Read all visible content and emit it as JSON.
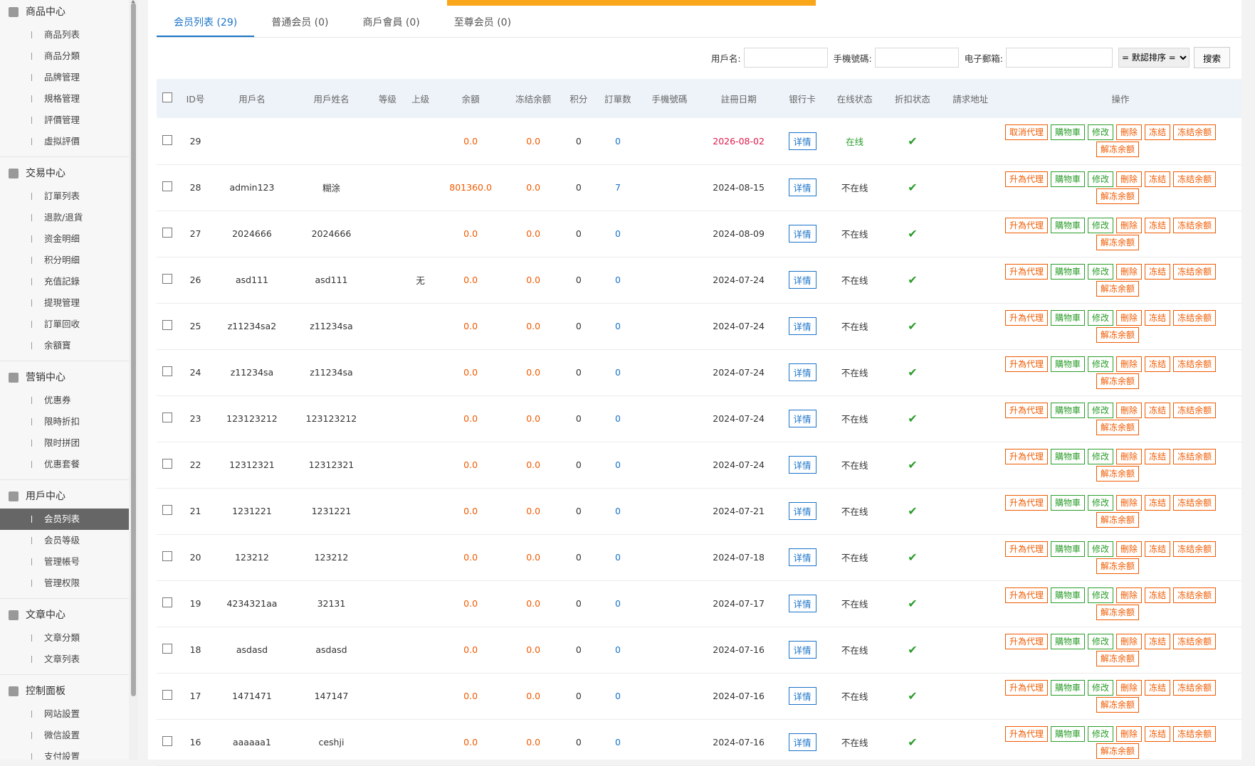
{
  "sidebar": {
    "groups": [
      {
        "title": "商品中心",
        "items": [
          "商品列表",
          "商品分類",
          "品牌管理",
          "規格管理",
          "評價管理",
          "虛拟評價"
        ]
      },
      {
        "title": "交易中心",
        "items": [
          "訂單列表",
          "退款/退貨",
          "资金明细",
          "积分明细",
          "充值記錄",
          "提現管理",
          "訂單回收",
          "余額寶"
        ]
      },
      {
        "title": "营销中心",
        "items": [
          "优惠券",
          "限時折扣",
          "限时拼团",
          "优惠套餐"
        ]
      },
      {
        "title": "用戶中心",
        "items": [
          "会员列表",
          "会员等级",
          "管理帳号",
          "管理权限"
        ]
      },
      {
        "title": "文章中心",
        "items": [
          "文章分類",
          "文章列表"
        ]
      },
      {
        "title": "控制面板",
        "items": [
          "网站設置",
          "微信設置",
          "支付設置"
        ]
      }
    ],
    "active": "会员列表"
  },
  "tabs": [
    "会员列表 (29)",
    "普通会员 (0)",
    "商戶會員 (0)",
    "至尊会员 (0)"
  ],
  "filter": {
    "username_label": "用戶名:",
    "phone_label": "手機號碼:",
    "email_label": "电子郵箱:",
    "sort": "= 默認排序 =",
    "search": "搜索"
  },
  "columns": [
    "ID号",
    "用戶名",
    "用戶姓名",
    "等级",
    "上级",
    "余額",
    "冻结余额",
    "积分",
    "訂單数",
    "手機號碼",
    "註冊日期",
    "银行卡",
    "在线状态",
    "折扣状态",
    "請求地址",
    "操作"
  ],
  "detail_label": "详情",
  "ops": {
    "agent_first": "取消代理",
    "agent": "升為代理",
    "cart": "購物車",
    "edit": "修改",
    "delete": "刪除",
    "freeze": "冻结",
    "freeze_bal": "冻结余额",
    "unfreeze_bal": "解冻余额"
  },
  "rows": [
    {
      "id": "29",
      "user": "",
      "name": "",
      "level": "",
      "parent": "",
      "bal": "0.0",
      "frozen": "0.0",
      "points": "0",
      "orders": "0",
      "date": "2026-08-02",
      "online": "在线"
    },
    {
      "id": "28",
      "user": "admin123",
      "name": "糊涂",
      "level": "",
      "parent": "",
      "bal": "801360.0",
      "frozen": "0.0",
      "points": "0",
      "orders": "7",
      "date": "2024-08-15",
      "online": "不在线"
    },
    {
      "id": "27",
      "user": "2024666",
      "name": "2024666",
      "level": "",
      "parent": "",
      "bal": "0.0",
      "frozen": "0.0",
      "points": "0",
      "orders": "0",
      "date": "2024-08-09",
      "online": "不在线"
    },
    {
      "id": "26",
      "user": "asd111",
      "name": "asd111",
      "level": "",
      "parent": "无",
      "bal": "0.0",
      "frozen": "0.0",
      "points": "0",
      "orders": "0",
      "date": "2024-07-24",
      "online": "不在线"
    },
    {
      "id": "25",
      "user": "z11234sa2",
      "name": "z11234sa",
      "level": "",
      "parent": "",
      "bal": "0.0",
      "frozen": "0.0",
      "points": "0",
      "orders": "0",
      "date": "2024-07-24",
      "online": "不在线"
    },
    {
      "id": "24",
      "user": "z11234sa",
      "name": "z11234sa",
      "level": "",
      "parent": "",
      "bal": "0.0",
      "frozen": "0.0",
      "points": "0",
      "orders": "0",
      "date": "2024-07-24",
      "online": "不在线"
    },
    {
      "id": "23",
      "user": "123123212",
      "name": "123123212",
      "level": "",
      "parent": "",
      "bal": "0.0",
      "frozen": "0.0",
      "points": "0",
      "orders": "0",
      "date": "2024-07-24",
      "online": "不在线"
    },
    {
      "id": "22",
      "user": "12312321",
      "name": "12312321",
      "level": "",
      "parent": "",
      "bal": "0.0",
      "frozen": "0.0",
      "points": "0",
      "orders": "0",
      "date": "2024-07-24",
      "online": "不在线"
    },
    {
      "id": "21",
      "user": "1231221",
      "name": "1231221",
      "level": "",
      "parent": "",
      "bal": "0.0",
      "frozen": "0.0",
      "points": "0",
      "orders": "0",
      "date": "2024-07-21",
      "online": "不在线"
    },
    {
      "id": "20",
      "user": "123212",
      "name": "123212",
      "level": "",
      "parent": "",
      "bal": "0.0",
      "frozen": "0.0",
      "points": "0",
      "orders": "0",
      "date": "2024-07-18",
      "online": "不在线"
    },
    {
      "id": "19",
      "user": "4234321aa",
      "name": "32131",
      "level": "",
      "parent": "",
      "bal": "0.0",
      "frozen": "0.0",
      "points": "0",
      "orders": "0",
      "date": "2024-07-17",
      "online": "不在线"
    },
    {
      "id": "18",
      "user": "asdasd",
      "name": "asdasd",
      "level": "",
      "parent": "",
      "bal": "0.0",
      "frozen": "0.0",
      "points": "0",
      "orders": "0",
      "date": "2024-07-16",
      "online": "不在线"
    },
    {
      "id": "17",
      "user": "1471471",
      "name": "147147",
      "level": "",
      "parent": "",
      "bal": "0.0",
      "frozen": "0.0",
      "points": "0",
      "orders": "0",
      "date": "2024-07-16",
      "online": "不在线"
    },
    {
      "id": "16",
      "user": "aaaaaa1",
      "name": "ceshji",
      "level": "",
      "parent": "",
      "bal": "0.0",
      "frozen": "0.0",
      "points": "0",
      "orders": "0",
      "date": "2024-07-16",
      "online": "不在线"
    }
  ]
}
